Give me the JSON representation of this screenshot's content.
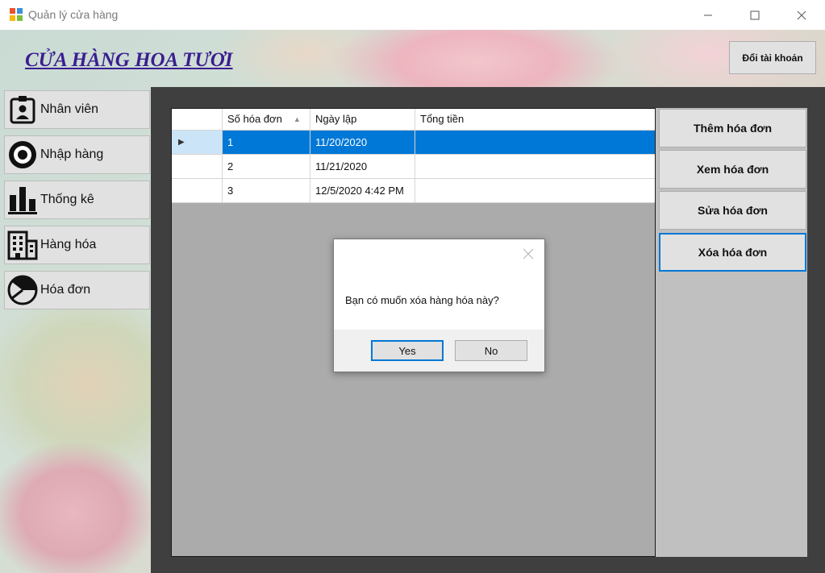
{
  "window": {
    "title": "Quản lý cửa hàng",
    "minimize_icon": "minimize-icon",
    "maximize_icon": "maximize-icon",
    "close_icon": "close-icon"
  },
  "header": {
    "shop_title": "CỬA HÀNG HOA TƯƠI",
    "switch_account": "Đổi tài khoản"
  },
  "sidebar": {
    "items": [
      {
        "label": "Nhân viên",
        "icon": "employee-badge-icon"
      },
      {
        "label": "Nhập hàng",
        "icon": "import-circle-icon"
      },
      {
        "label": "Thống kê",
        "icon": "bar-chart-icon"
      },
      {
        "label": "Hàng hóa",
        "icon": "buildings-icon"
      },
      {
        "label": "Hóa đơn",
        "icon": "invoice-pie-icon"
      }
    ]
  },
  "grid": {
    "columns": [
      "",
      "Số hóa đơn",
      "Ngày lập",
      "Tổng tiền"
    ],
    "sort_indicator": "▲",
    "rows": [
      {
        "pointer": "▶",
        "invoice_no": "1",
        "date": "11/20/2020",
        "total": ""
      },
      {
        "pointer": "",
        "invoice_no": "2",
        "date": "11/21/2020",
        "total": ""
      },
      {
        "pointer": "",
        "invoice_no": "3",
        "date": "12/5/2020 4:42 PM",
        "total": ""
      }
    ],
    "selected_row": 0,
    "selection_color": "#0078d7"
  },
  "actions": {
    "add": "Thêm hóa đơn",
    "view": "Xem hóa đơn",
    "edit": "Sửa hóa đơn",
    "delete": "Xóa hóa đơn"
  },
  "dialog": {
    "message": "Bạn có muốn xóa hàng hóa này?",
    "yes": "Yes",
    "no": "No"
  },
  "colors": {
    "accent": "#0078d7",
    "title_text": "#3b1d8f",
    "panel_dark": "#3f3f3f"
  }
}
